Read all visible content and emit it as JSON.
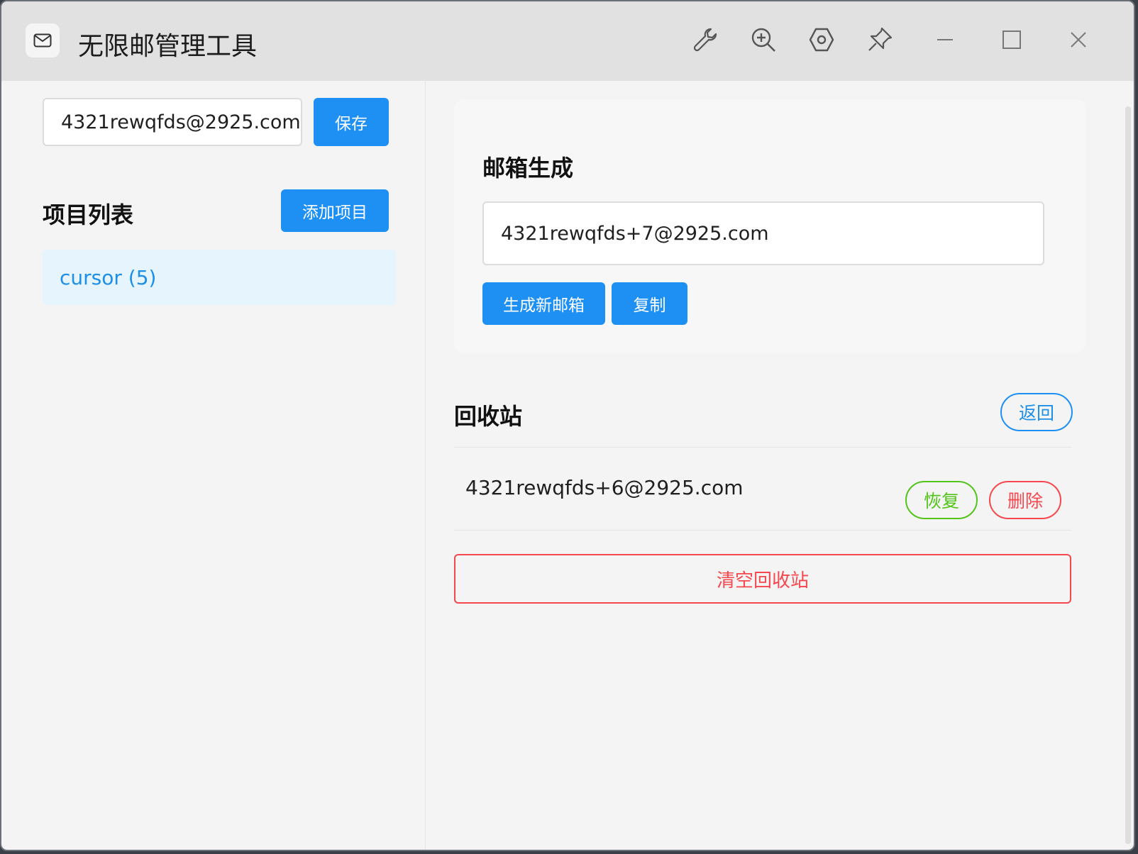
{
  "window": {
    "title": "无限邮管理工具",
    "icons": [
      "mail-icon",
      "wrench-icon",
      "zoom-in-icon",
      "settings-hex-icon",
      "pin-icon",
      "minimize-icon",
      "maximize-icon",
      "close-icon"
    ]
  },
  "left": {
    "email_value": "4321rewqfds@2925.com",
    "save_label": "保存",
    "projects_title": "项目列表",
    "add_project_label": "添加项目",
    "projects": [
      {
        "label": "cursor (5)"
      }
    ]
  },
  "generator": {
    "title": "邮箱生成",
    "generated_value": "4321rewqfds+7@2925.com",
    "generate_label": "生成新邮箱",
    "copy_label": "复制"
  },
  "recycle": {
    "title": "回收站",
    "back_label": "返回",
    "items": [
      {
        "email": "4321rewqfds+6@2925.com",
        "restore_label": "恢复",
        "delete_label": "删除"
      }
    ],
    "clear_label": "清空回收站"
  },
  "colors": {
    "primary": "#1e90f4",
    "success": "#52c41a",
    "danger": "#f5474d",
    "selected_bg": "#e6f4fd"
  }
}
